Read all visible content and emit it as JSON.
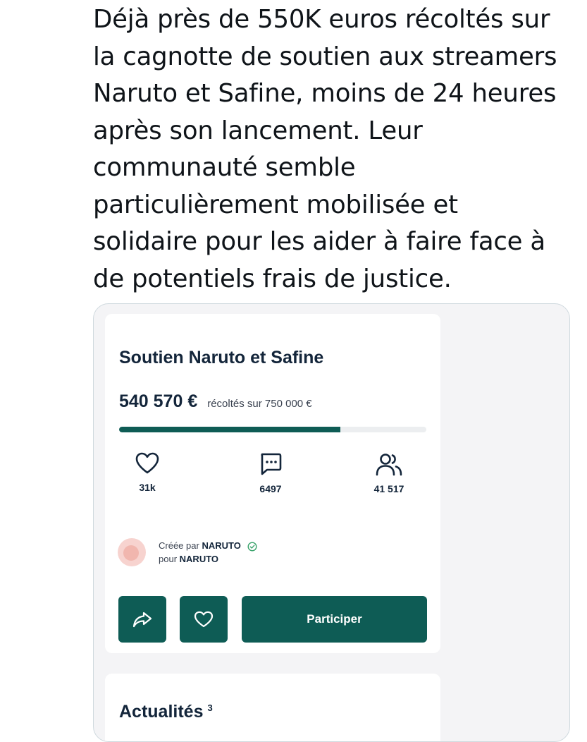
{
  "tweet": {
    "text": "Déjà près de 550K euros récoltés sur\nla cagnotte de soutien aux streamers\nNaruto et Safine, moins de 24 heures\naprès son lancement. Leur\ncommunauté semble\nparticulièrement mobilisée et\nsolidaire pour les aider à faire face à\nde potentiels frais de justice."
  },
  "campaign": {
    "title": "Soutien Naruto et Safine",
    "amount": "540 570 €",
    "goal_text": "récoltés sur 750 000 €",
    "progress_fraction": 0.72,
    "stats": {
      "likes": "31k",
      "comments": "6497",
      "contributors": "41 517"
    },
    "creator": {
      "created_by_prefix": "Créée par",
      "created_by_name": "NARUTO",
      "for_prefix": "pour",
      "for_name": "NARUTO"
    },
    "participate_label": "Participer"
  },
  "news": {
    "title": "Actualités",
    "count": "3"
  },
  "colors": {
    "accent": "#0e5c55",
    "heading": "#13253a",
    "avatar": "#f7d3cf"
  },
  "icons": [
    "heart-icon",
    "comment-icon",
    "users-icon",
    "verified-icon",
    "share-icon",
    "heart-outline-icon"
  ]
}
